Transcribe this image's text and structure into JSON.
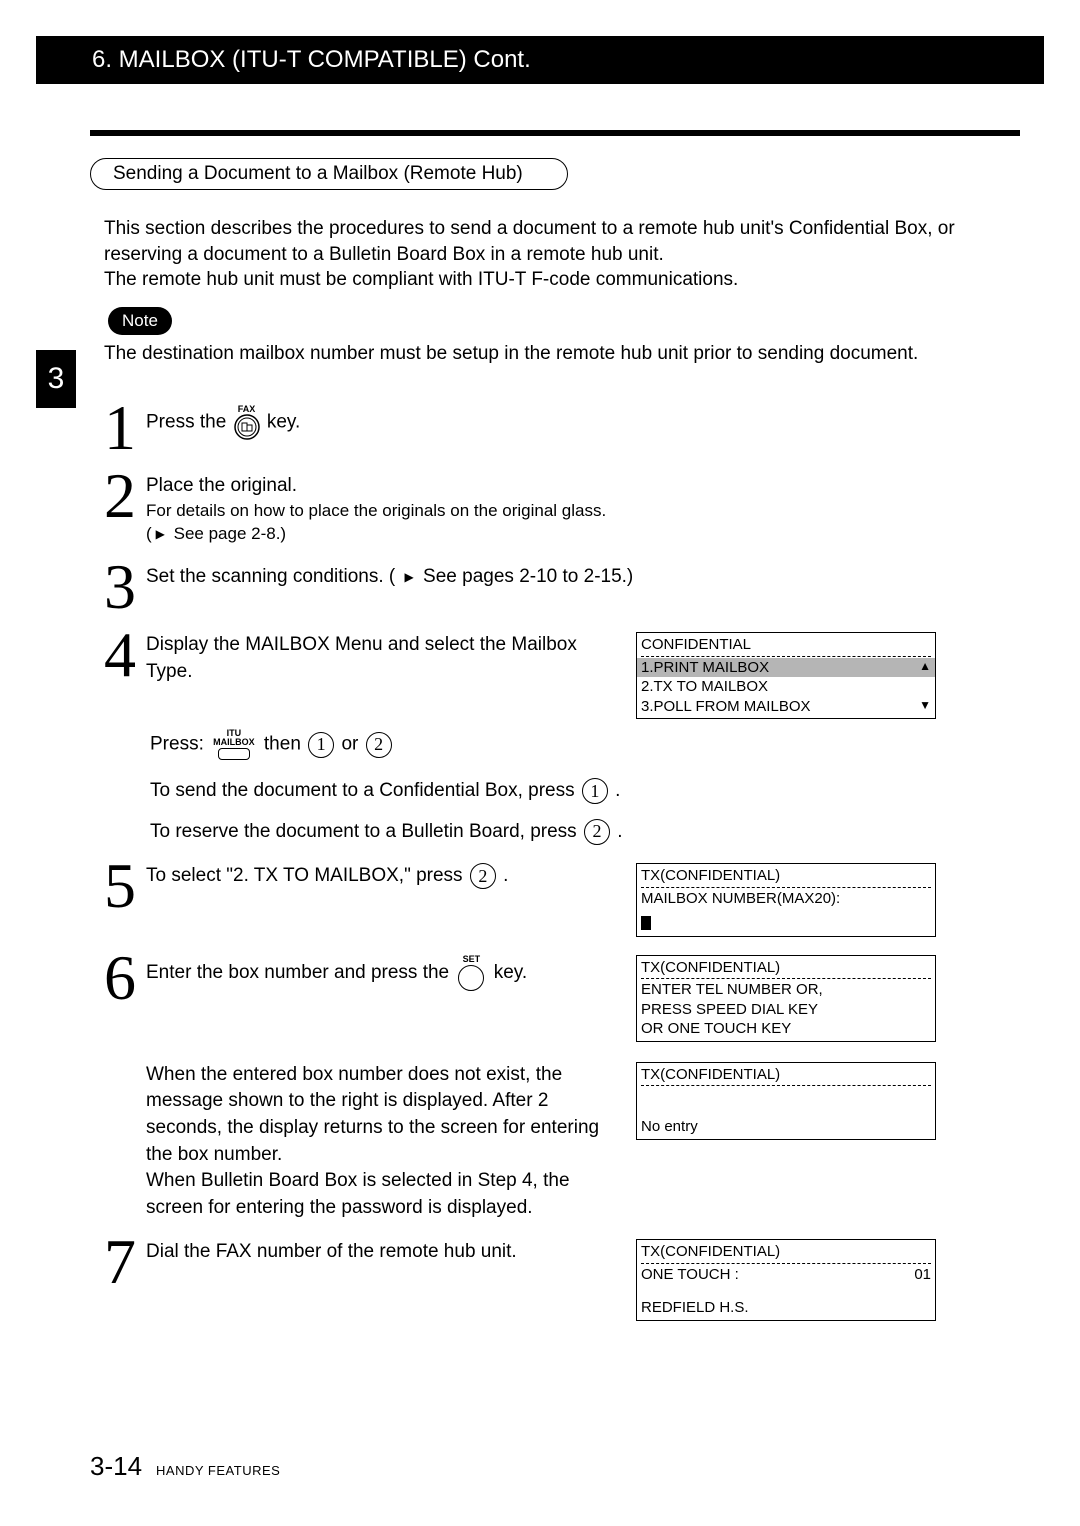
{
  "header": {
    "title": "6. MAILBOX (ITU-T COMPATIBLE) Cont."
  },
  "side_tab": "3",
  "subtitle": "Sending a Document to a Mailbox (Remote Hub)",
  "intro": {
    "l1": "This section describes the procedures to send a document to a remote hub unit's Confidential Box, or reserving a document to a Bulletin Board Box in a remote hub unit.",
    "l2": "The remote hub unit must be compliant with ITU-T F-code communications."
  },
  "note": {
    "badge": "Note",
    "text": "The destination mailbox number must be setup in the remote hub unit prior to sending document."
  },
  "labels": {
    "fax": "FAX",
    "itu": "ITU",
    "mailbox": "MAILBOX",
    "set": "SET",
    "press_the": "Press the ",
    "key_dot": " key.",
    "press": "Press: ",
    "then": " then ",
    "or": " or ",
    "see_page28": " See page 2-8.)",
    "see_pages": " See pages 2-10 to 2-15.)"
  },
  "steps": {
    "s1": {
      "n": "1"
    },
    "s2": {
      "n": "2",
      "t": "Place the original.",
      "sub": "For details on how to place the originals on the original glass."
    },
    "s3": {
      "n": "3",
      "t": "Set the scanning conditions. ("
    },
    "s4": {
      "n": "4",
      "t": "Display the MAILBOX Menu and select the Mailbox Type.",
      "sub1_a": "To send the document to a Confidential Box, press ",
      "sub1_b": ".",
      "sub2_a": "To reserve the document to a Bulletin Board, press ",
      "sub2_b": "."
    },
    "s5": {
      "n": "5",
      "t_a": "To select \"2. TX TO MAILBOX,\" press ",
      "t_b": "."
    },
    "s6": {
      "n": "6",
      "t_a": "Enter the box number and press the ",
      "t_b": " key.",
      "para1": "When the entered box number does not exist, the message shown to the right is displayed. After 2 seconds, the display returns to the screen for entering the box number.",
      "para2": "When Bulletin Board Box is selected in Step 4, the screen for entering the password is displayed."
    },
    "s7": {
      "n": "7",
      "t": "Dial the FAX number of the remote hub unit."
    }
  },
  "lcd": {
    "s4": {
      "hdr": "CONFIDENTIAL",
      "i1": "1.PRINT MAILBOX",
      "i2": "2.TX TO MAILBOX",
      "i3": "3.POLL FROM MAILBOX"
    },
    "s5": {
      "hdr": "TX(CONFIDENTIAL)",
      "l1": "MAILBOX NUMBER(MAX20):"
    },
    "s6a": {
      "hdr": "TX(CONFIDENTIAL)",
      "l1": "ENTER TEL NUMBER OR,",
      "l2": "PRESS SPEED DIAL KEY",
      "l3": "OR ONE TOUCH KEY"
    },
    "s6b": {
      "hdr": "TX(CONFIDENTIAL)",
      "l1": "No entry"
    },
    "s7": {
      "hdr": "TX(CONFIDENTIAL)",
      "l1": "ONE TOUCH :",
      "num": "01",
      "l2": "REDFIELD H.S."
    }
  },
  "keys": {
    "k1": "1",
    "k2": "2"
  },
  "footer": {
    "page": "3-14",
    "label": "HANDY FEATURES"
  }
}
